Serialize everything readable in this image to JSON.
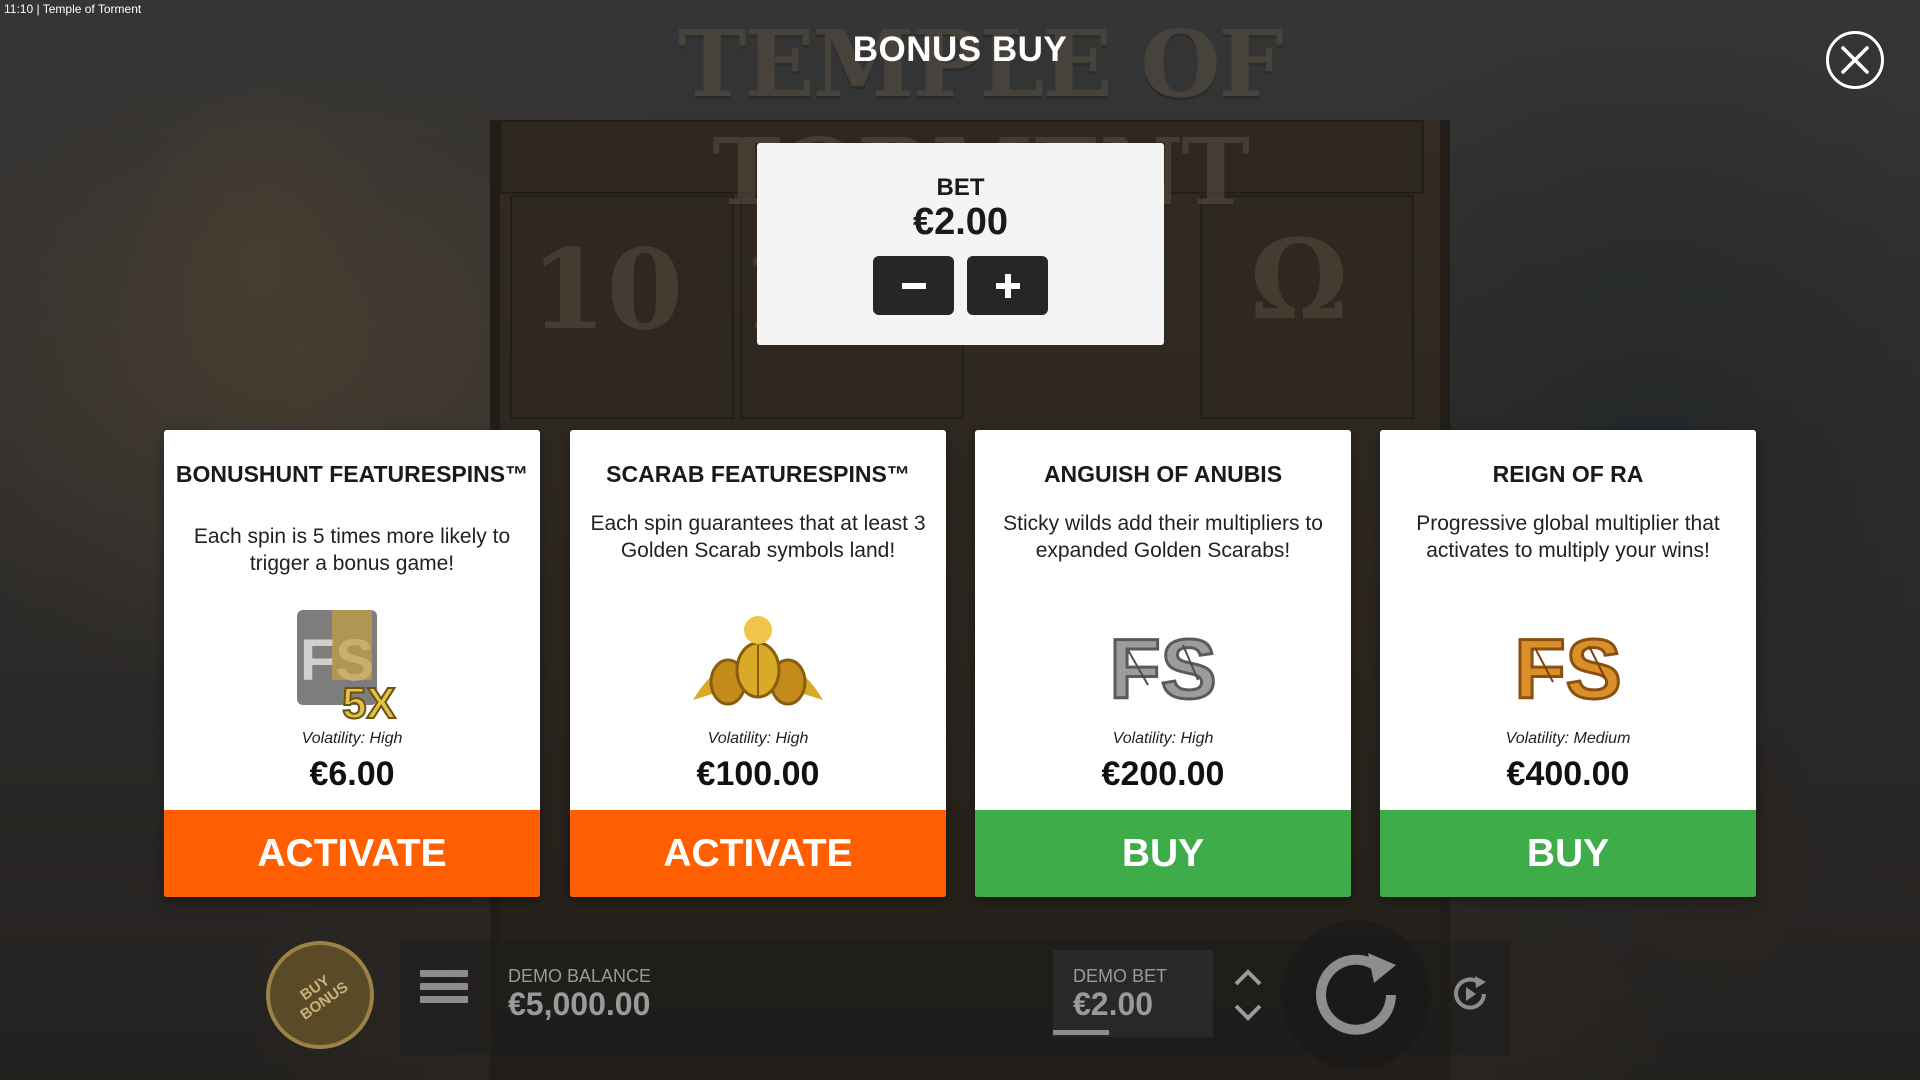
{
  "window": {
    "time": "11:10",
    "title": "Temple of Torment"
  },
  "background": {
    "game_logo": "TEMPLE OF TORMENT"
  },
  "modal": {
    "title": "BONUS BUY",
    "close_icon": "close-icon"
  },
  "bet": {
    "label": "BET",
    "value": "€2.00",
    "decrease_icon": "minus-icon",
    "increase_icon": "plus-icon"
  },
  "cards": [
    {
      "title": "BONUSHUNT FEATURESPINS™",
      "description": "Each spin is 5 times more likely to trigger a bonus game!",
      "image_icon": "fs-5x-badge",
      "image_text": "5X",
      "volatility": "Volatility: High",
      "price": "€6.00",
      "button": "ACTIVATE",
      "button_color": "#ff5f00"
    },
    {
      "title": "SCARAB FEATURESPINS™",
      "description": "Each spin guarantees that at least 3 Golden Scarab symbols land!",
      "image_icon": "golden-scarabs",
      "volatility": "Volatility: High",
      "price": "€100.00",
      "button": "ACTIVATE",
      "button_color": "#ff5f00"
    },
    {
      "title": "ANGUISH OF ANUBIS",
      "description": "Sticky wilds add their multipliers to expanded Golden Scarabs!",
      "image_icon": "fs-stone-badge",
      "volatility": "Volatility: High",
      "price": "€200.00",
      "button": "BUY",
      "button_color": "#3eac48"
    },
    {
      "title": "REIGN OF RA",
      "description": "Progressive global multiplier that activates to multiply your wins!",
      "image_icon": "fs-gold-badge",
      "volatility": "Volatility: Medium",
      "price": "€400.00",
      "button": "BUY",
      "button_color": "#3eac48"
    }
  ],
  "bottom_bar": {
    "buy_bonus": "BUY BONUS",
    "menu_icon": "hamburger-menu-icon",
    "balance_label": "DEMO BALANCE",
    "balance_value": "€5,000.00",
    "bet_label": "DEMO BET",
    "bet_value": "€2.00",
    "bet_arrows_icon": "up-down-arrows-icon",
    "spin_icon": "spin-icon",
    "autoplay_icon": "autoplay-icon"
  }
}
